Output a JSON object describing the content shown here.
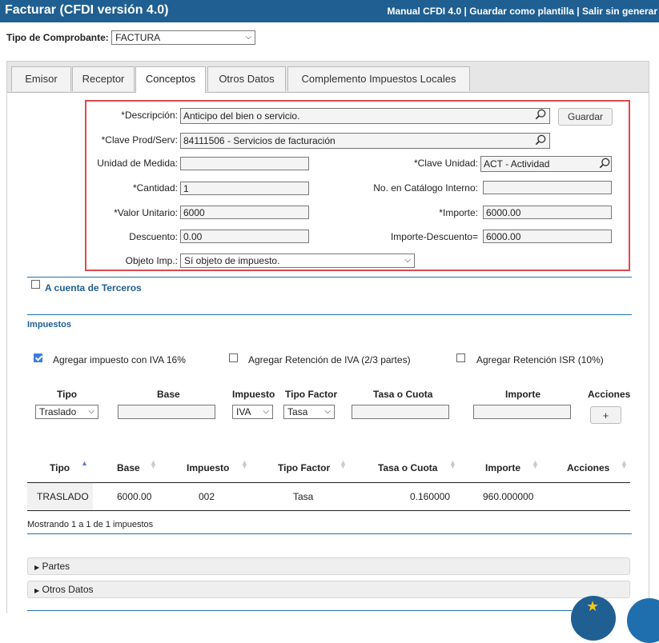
{
  "header": {
    "title": "Facturar (CFDI versión 4.0)",
    "links": [
      "Manual CFDI 4.0",
      "Guardar como plantilla",
      "Salir sin generar"
    ],
    "separator": "|"
  },
  "comprobante": {
    "label": "Tipo de Comprobante:",
    "value": "FACTURA"
  },
  "tabs": [
    "Emisor",
    "Receptor",
    "Conceptos",
    "Otros Datos",
    "Complemento Impuestos Locales"
  ],
  "active_tab": "Conceptos",
  "concepto": {
    "descripcion_label": "*Descripción:",
    "descripcion_value": "Anticipo del bien o servicio.",
    "guardar_label": "Guardar",
    "clave_prod_label": "*Clave Prod/Serv:",
    "clave_prod_value": "84111506 - Servicios de facturación",
    "unidad_label": "Unidad de Medida:",
    "unidad_value": "",
    "clave_unidad_label": "*Clave Unidad:",
    "clave_unidad_value": "ACT - Actividad",
    "cantidad_label": "*Cantidad:",
    "cantidad_value": "1",
    "catalogo_label": "No. en Catálogo Interno:",
    "catalogo_value": "",
    "valor_label": "*Valor Unitario:",
    "valor_value": "6000",
    "importe_label": "*Importe:",
    "importe_value": "6000.00",
    "descuento_label": "Descuento:",
    "descuento_value": "0.00",
    "importe_desc_label": "Importe-Descuento=",
    "importe_desc_value": "6000.00",
    "objeto_label": "Objeto Imp.:",
    "objeto_value": "Sí objeto de impuesto."
  },
  "terceros_label": "A cuenta de Terceros",
  "impuestos": {
    "title": "Impuestos",
    "check_iva": "Agregar impuesto con  IVA 16%",
    "check_ret_iva": "Agregar Retención de IVA (2/3 partes)",
    "check_ret_isr": "Agregar Retención ISR (10%)",
    "form_headers": [
      "Tipo",
      "Base",
      "Impuesto",
      "Tipo Factor",
      "Tasa o Cuota",
      "Importe",
      "Acciones"
    ],
    "tipo_value": "Traslado",
    "impuesto_value": "IVA",
    "factor_value": "Tasa",
    "add_label": "+",
    "table_headers": [
      "Tipo",
      "Base",
      "Impuesto",
      "Tipo Factor",
      "Tasa o Cuota",
      "Importe",
      "Acciones"
    ],
    "rows": [
      {
        "tipo": "TRASLADO",
        "base": "6000.00",
        "impuesto": "002",
        "factor": "Tasa",
        "tasa": "0.160000",
        "importe": "960.000000"
      }
    ],
    "footer": "Mostrando 1 a 1 de 1 impuestos"
  },
  "sections": [
    "Partes",
    "Otros Datos"
  ],
  "colors": {
    "header": "#1f5f92",
    "accent": "#1f6fae",
    "highlight": "#e0484e",
    "fab": "#1f5f92",
    "star": "#f5c518"
  }
}
